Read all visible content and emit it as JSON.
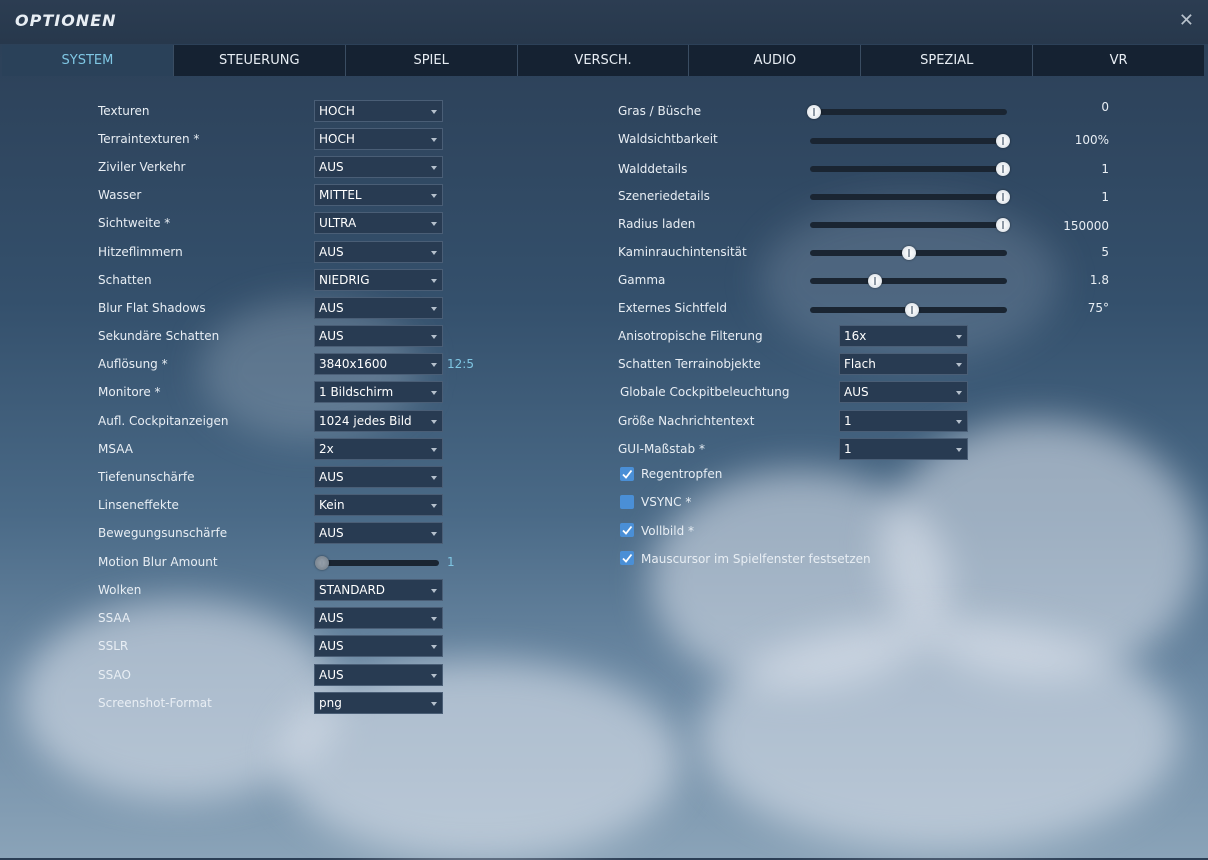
{
  "window": {
    "title": "OPTIONEN",
    "close_symbol": "✕"
  },
  "tabs": [
    {
      "label": "SYSTEM",
      "active": true
    },
    {
      "label": "STEUERUNG"
    },
    {
      "label": "SPIEL"
    },
    {
      "label": "VERSCH."
    },
    {
      "label": "AUDIO"
    },
    {
      "label": "SPEZIAL"
    },
    {
      "label": "VR"
    }
  ],
  "left": {
    "texturen": {
      "label": "Texturen",
      "value": "HOCH"
    },
    "terraintexturen": {
      "label": "Terraintexturen *",
      "value": "HOCH"
    },
    "ziviler_verkehr": {
      "label": "Ziviler Verkehr",
      "value": "AUS"
    },
    "wasser": {
      "label": "Wasser",
      "value": "MITTEL"
    },
    "sichtweite": {
      "label": "Sichtweite *",
      "value": "ULTRA"
    },
    "hitzeflimmern": {
      "label": "Hitzeflimmern",
      "value": "AUS"
    },
    "schatten": {
      "label": "Schatten",
      "value": "NIEDRIG"
    },
    "blur_flat_shadows": {
      "label": "Blur Flat Shadows",
      "value": "AUS"
    },
    "sekundaere_schatten": {
      "label": "Sekundäre Schatten",
      "value": "AUS"
    },
    "aufloesung": {
      "label": "Auflösung *",
      "value": "3840x1600",
      "aspect": "12:5"
    },
    "monitore": {
      "label": "Monitore *",
      "value": "1 Bildschirm"
    },
    "cockpitanzeigen": {
      "label": "Aufl. Cockpitanzeigen",
      "value": "1024 jedes Bild"
    },
    "msaa": {
      "label": "MSAA",
      "value": "2x"
    },
    "tiefenunschaerfe": {
      "label": "Tiefenunschärfe",
      "value": "AUS"
    },
    "linseneffekte": {
      "label": "Linseneffekte",
      "value": "Kein"
    },
    "bewegungsunschaerfe": {
      "label": "Bewegungsunschärfe",
      "value": "AUS"
    },
    "motion_blur_amount": {
      "label": "Motion Blur Amount",
      "value": "1",
      "fraction": 0.03
    },
    "wolken": {
      "label": "Wolken",
      "value": "STANDARD"
    },
    "ssaa": {
      "label": "SSAA",
      "value": "AUS"
    },
    "sslr": {
      "label": "SSLR",
      "value": "AUS"
    },
    "ssao": {
      "label": "SSAO",
      "value": "AUS"
    },
    "screenshot_format": {
      "label": "Screenshot-Format",
      "value": "png"
    }
  },
  "right": {
    "sliders": [
      {
        "label": "Gras / Büsche",
        "value": "0",
        "fraction": 0.02
      },
      {
        "label": "Waldsichtbarkeit",
        "value": "100%",
        "fraction": 0.98
      },
      {
        "label": "Walddetails",
        "value": "1",
        "fraction": 0.98
      },
      {
        "label": "Szeneriedetails",
        "value": "1",
        "fraction": 0.98
      },
      {
        "label": "Radius laden",
        "value": "150000",
        "fraction": 0.98
      },
      {
        "label": "Kaminrauchintensität",
        "value": "5",
        "fraction": 0.5
      },
      {
        "label": "Gamma",
        "value": "1.8",
        "fraction": 0.33
      },
      {
        "label": "Externes Sichtfeld",
        "value": "75°",
        "fraction": 0.52
      }
    ],
    "anisotropische_filterung": {
      "label": "Anisotropische Filterung",
      "value": "16x"
    },
    "schatten_terrainobjekte": {
      "label": "Schatten Terrainobjekte",
      "value": "Flach"
    },
    "globale_cockpitbeleuchtung": {
      "label": "Globale Cockpitbeleuchtung",
      "value": "AUS"
    },
    "nachrichtentext": {
      "label": "Größe Nachrichtentext",
      "value": "1"
    },
    "gui_massstab": {
      "label": "GUI-Maßstab *",
      "value": "1"
    },
    "checkboxes": [
      {
        "label": "Regentropfen",
        "checked": true
      },
      {
        "label": "VSYNC *",
        "checked": false
      },
      {
        "label": "Vollbild *",
        "checked": true
      },
      {
        "label": "Mauscursor im Spielfenster festsetzen",
        "checked": true
      }
    ]
  },
  "colors": {
    "accent": "#7fc6e3",
    "checkbox": "#4a8fd6",
    "tab_active_bg": "#2a4159",
    "tab_bg": "#152232"
  }
}
